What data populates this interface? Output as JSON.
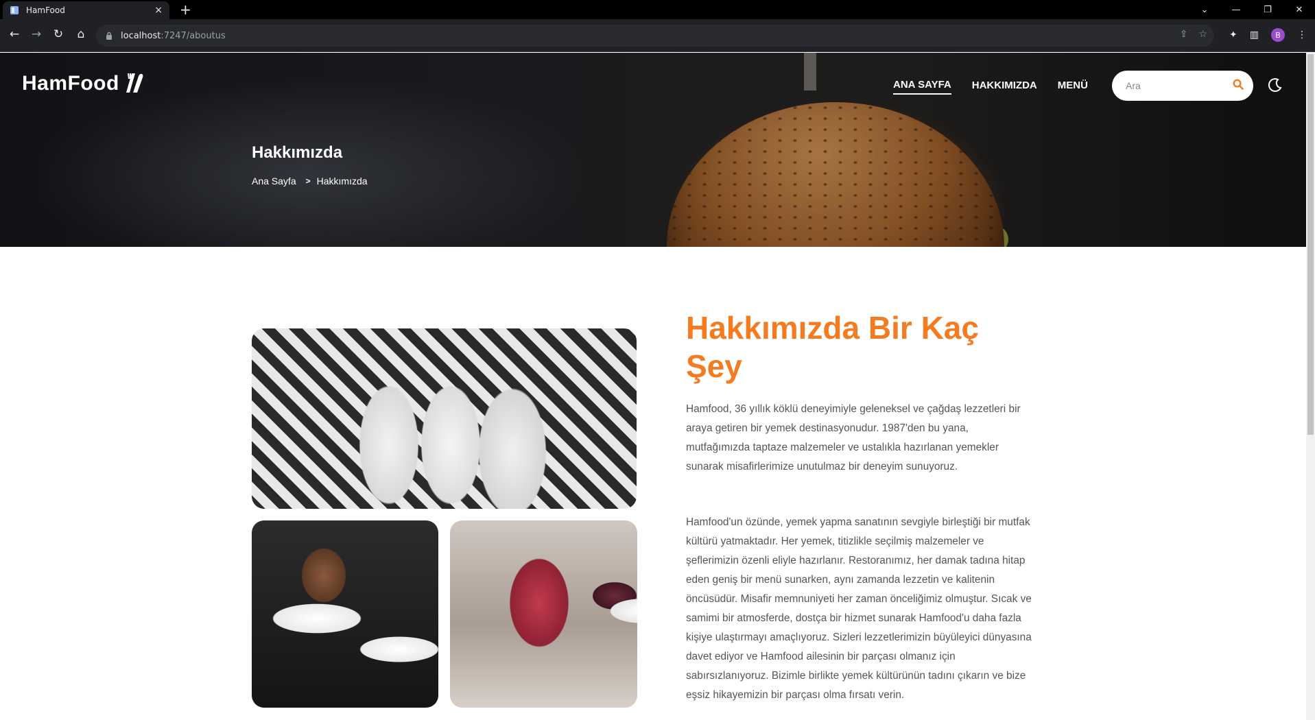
{
  "browser": {
    "tab_title": "HamFood",
    "tab_close": "×",
    "new_tab": "+",
    "url_host": "localhost",
    "url_path": ":7247/aboutus",
    "profile_initial": "B"
  },
  "header": {
    "logo_text": "HamFood",
    "nav": [
      {
        "label": "ANA SAYFA",
        "active": true
      },
      {
        "label": "HAKKIMIZDA",
        "active": false
      },
      {
        "label": "MENÜ",
        "active": false
      }
    ],
    "search_placeholder": "Ara",
    "icons": {
      "search": "search-icon",
      "theme": "moon-icon"
    },
    "accent_color": "#f47b20"
  },
  "hero": {
    "title": "Hakkımızda",
    "breadcrumb": [
      "Ana Sayfa",
      "Hakkımızda"
    ]
  },
  "about": {
    "title": "Hakkımızda Bir Kaç Şey",
    "paragraph_1": "Hamfood, 36 yıllık köklü deneyimiyle geleneksel ve çağdaş lezzetleri bir araya getiren bir yemek destinasyonudur. 1987'den bu yana, mutfağımızda taptaze malzemeler ve ustalıkla hazırlanan yemekler sunarak misafirlerimize unutulmaz bir deneyim sunuyoruz.",
    "paragraph_2": "Hamfood'un özünde, yemek yapma sanatının sevgiyle birleştiği bir mutfak kültürü yatmaktadır. Her yemek, titizlikle seçilmiş malzemeler ve şeflerimizin özenli eliyle hazırlanır. Restoranımız, her damak tadına hitap eden geniş bir menü sunarken, aynı zamanda lezzetin ve kalitenin öncüsüdür. Misafir memnuniyeti her zaman önceliğimiz olmuştur. Sıcak ve samimi bir atmosferde, dostça bir hizmet sunarak Hamfood'u daha fazla kişiye ulaştırmayı amaçlıyoruz. Sizleri lezzetlerimizin büyüleyici dünyasına davet ediyor ve Hamfood ailesinin bir parçası olmanız için sabırsızlanıyoruz. Bizimle birlikte yemek kültürünün tadını çıkarın ve bize eşsiz hikayemizin bir parçası olma fırsatı verin."
  }
}
